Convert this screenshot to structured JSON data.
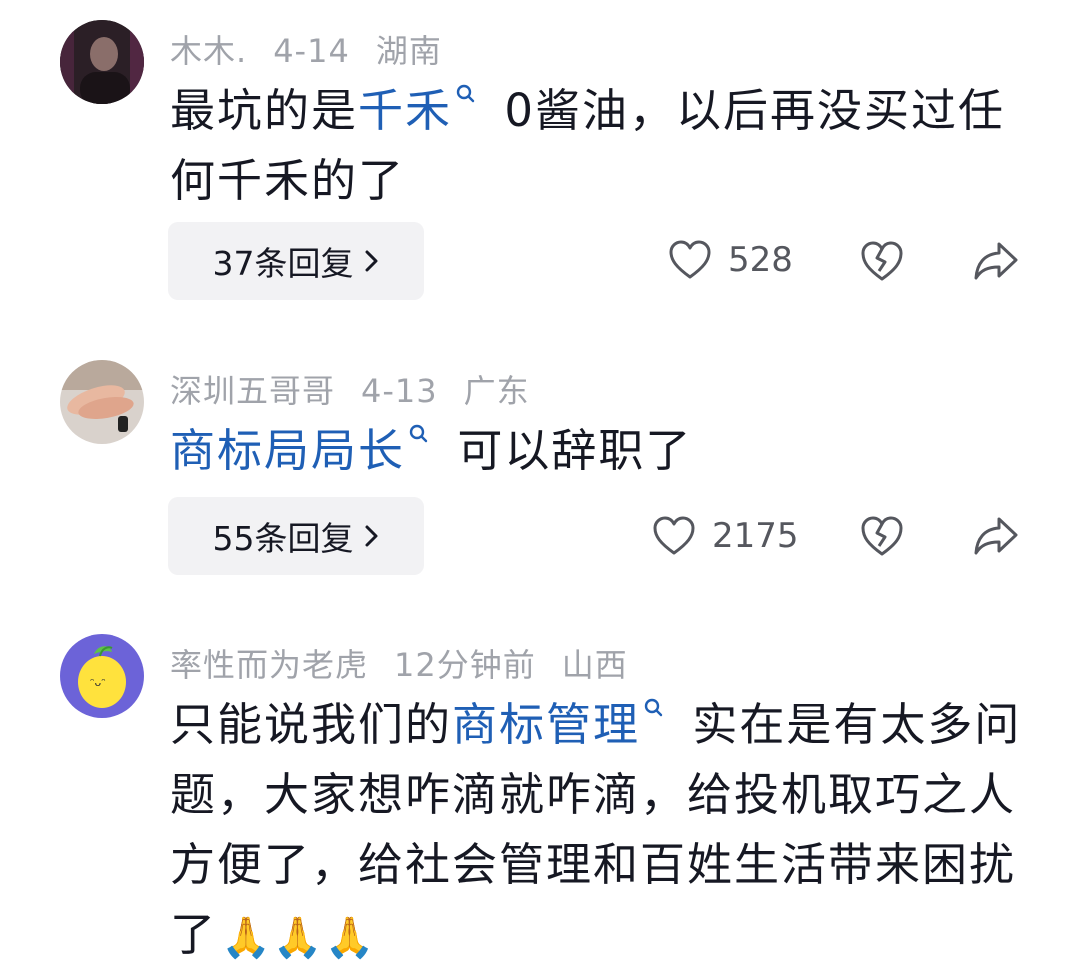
{
  "comments": [
    {
      "username": "木木.",
      "date": "4-14",
      "location": "湖南",
      "text_before": "最坑的是",
      "link": "千禾",
      "text_after": " 0酱油，以后再没买过任何千禾的了",
      "replies_label": "37条回复",
      "likes": "528"
    },
    {
      "username": "深圳五哥哥",
      "date": "4-13",
      "location": "广东",
      "text_before": "",
      "link": "商标局局长",
      "text_after": " 可以辞职了",
      "replies_label": "55条回复",
      "likes": "2175"
    },
    {
      "username": "率性而为老虎",
      "date": "12分钟前",
      "location": "山西",
      "text_before": "只能说我们的",
      "link": "商标管理",
      "text_after": " 实在是有太多问题，大家想咋滴就咋滴，给投机取巧之人方便了，给社会管理和百姓生活带来困扰了",
      "emoji": "🙏🙏🙏"
    }
  ],
  "colors": {
    "link": "#1f5fb5",
    "meta": "#a0a3aa",
    "text": "#161823",
    "button_bg": "#f2f2f4"
  },
  "icons": [
    "search-icon",
    "heart-icon",
    "broken-heart-icon",
    "share-icon",
    "chevron-right-icon",
    "pray-emoji"
  ]
}
